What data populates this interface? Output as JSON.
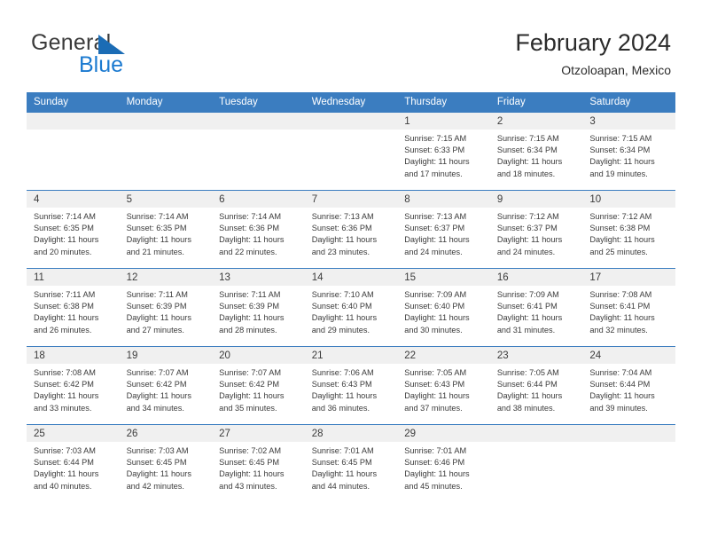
{
  "brand": {
    "name_top": "General",
    "name_bottom": "Blue",
    "triangle_icon": "triangle-icon",
    "accent_blue": "#1b7ad0",
    "header_blue": "#3b7dc0"
  },
  "header": {
    "title": "February 2024",
    "subtitle": "Otzoloapan, Mexico"
  },
  "weekdays": [
    "Sunday",
    "Monday",
    "Tuesday",
    "Wednesday",
    "Thursday",
    "Friday",
    "Saturday"
  ],
  "weeks": [
    [
      {
        "day": "",
        "sunrise": "",
        "sunset": "",
        "daylight_line1": "",
        "daylight_line2": ""
      },
      {
        "day": "",
        "sunrise": "",
        "sunset": "",
        "daylight_line1": "",
        "daylight_line2": ""
      },
      {
        "day": "",
        "sunrise": "",
        "sunset": "",
        "daylight_line1": "",
        "daylight_line2": ""
      },
      {
        "day": "",
        "sunrise": "",
        "sunset": "",
        "daylight_line1": "",
        "daylight_line2": ""
      },
      {
        "day": "1",
        "sunrise": "Sunrise: 7:15 AM",
        "sunset": "Sunset: 6:33 PM",
        "daylight_line1": "Daylight: 11 hours",
        "daylight_line2": "and 17 minutes."
      },
      {
        "day": "2",
        "sunrise": "Sunrise: 7:15 AM",
        "sunset": "Sunset: 6:34 PM",
        "daylight_line1": "Daylight: 11 hours",
        "daylight_line2": "and 18 minutes."
      },
      {
        "day": "3",
        "sunrise": "Sunrise: 7:15 AM",
        "sunset": "Sunset: 6:34 PM",
        "daylight_line1": "Daylight: 11 hours",
        "daylight_line2": "and 19 minutes."
      }
    ],
    [
      {
        "day": "4",
        "sunrise": "Sunrise: 7:14 AM",
        "sunset": "Sunset: 6:35 PM",
        "daylight_line1": "Daylight: 11 hours",
        "daylight_line2": "and 20 minutes."
      },
      {
        "day": "5",
        "sunrise": "Sunrise: 7:14 AM",
        "sunset": "Sunset: 6:35 PM",
        "daylight_line1": "Daylight: 11 hours",
        "daylight_line2": "and 21 minutes."
      },
      {
        "day": "6",
        "sunrise": "Sunrise: 7:14 AM",
        "sunset": "Sunset: 6:36 PM",
        "daylight_line1": "Daylight: 11 hours",
        "daylight_line2": "and 22 minutes."
      },
      {
        "day": "7",
        "sunrise": "Sunrise: 7:13 AM",
        "sunset": "Sunset: 6:36 PM",
        "daylight_line1": "Daylight: 11 hours",
        "daylight_line2": "and 23 minutes."
      },
      {
        "day": "8",
        "sunrise": "Sunrise: 7:13 AM",
        "sunset": "Sunset: 6:37 PM",
        "daylight_line1": "Daylight: 11 hours",
        "daylight_line2": "and 24 minutes."
      },
      {
        "day": "9",
        "sunrise": "Sunrise: 7:12 AM",
        "sunset": "Sunset: 6:37 PM",
        "daylight_line1": "Daylight: 11 hours",
        "daylight_line2": "and 24 minutes."
      },
      {
        "day": "10",
        "sunrise": "Sunrise: 7:12 AM",
        "sunset": "Sunset: 6:38 PM",
        "daylight_line1": "Daylight: 11 hours",
        "daylight_line2": "and 25 minutes."
      }
    ],
    [
      {
        "day": "11",
        "sunrise": "Sunrise: 7:11 AM",
        "sunset": "Sunset: 6:38 PM",
        "daylight_line1": "Daylight: 11 hours",
        "daylight_line2": "and 26 minutes."
      },
      {
        "day": "12",
        "sunrise": "Sunrise: 7:11 AM",
        "sunset": "Sunset: 6:39 PM",
        "daylight_line1": "Daylight: 11 hours",
        "daylight_line2": "and 27 minutes."
      },
      {
        "day": "13",
        "sunrise": "Sunrise: 7:11 AM",
        "sunset": "Sunset: 6:39 PM",
        "daylight_line1": "Daylight: 11 hours",
        "daylight_line2": "and 28 minutes."
      },
      {
        "day": "14",
        "sunrise": "Sunrise: 7:10 AM",
        "sunset": "Sunset: 6:40 PM",
        "daylight_line1": "Daylight: 11 hours",
        "daylight_line2": "and 29 minutes."
      },
      {
        "day": "15",
        "sunrise": "Sunrise: 7:09 AM",
        "sunset": "Sunset: 6:40 PM",
        "daylight_line1": "Daylight: 11 hours",
        "daylight_line2": "and 30 minutes."
      },
      {
        "day": "16",
        "sunrise": "Sunrise: 7:09 AM",
        "sunset": "Sunset: 6:41 PM",
        "daylight_line1": "Daylight: 11 hours",
        "daylight_line2": "and 31 minutes."
      },
      {
        "day": "17",
        "sunrise": "Sunrise: 7:08 AM",
        "sunset": "Sunset: 6:41 PM",
        "daylight_line1": "Daylight: 11 hours",
        "daylight_line2": "and 32 minutes."
      }
    ],
    [
      {
        "day": "18",
        "sunrise": "Sunrise: 7:08 AM",
        "sunset": "Sunset: 6:42 PM",
        "daylight_line1": "Daylight: 11 hours",
        "daylight_line2": "and 33 minutes."
      },
      {
        "day": "19",
        "sunrise": "Sunrise: 7:07 AM",
        "sunset": "Sunset: 6:42 PM",
        "daylight_line1": "Daylight: 11 hours",
        "daylight_line2": "and 34 minutes."
      },
      {
        "day": "20",
        "sunrise": "Sunrise: 7:07 AM",
        "sunset": "Sunset: 6:42 PM",
        "daylight_line1": "Daylight: 11 hours",
        "daylight_line2": "and 35 minutes."
      },
      {
        "day": "21",
        "sunrise": "Sunrise: 7:06 AM",
        "sunset": "Sunset: 6:43 PM",
        "daylight_line1": "Daylight: 11 hours",
        "daylight_line2": "and 36 minutes."
      },
      {
        "day": "22",
        "sunrise": "Sunrise: 7:05 AM",
        "sunset": "Sunset: 6:43 PM",
        "daylight_line1": "Daylight: 11 hours",
        "daylight_line2": "and 37 minutes."
      },
      {
        "day": "23",
        "sunrise": "Sunrise: 7:05 AM",
        "sunset": "Sunset: 6:44 PM",
        "daylight_line1": "Daylight: 11 hours",
        "daylight_line2": "and 38 minutes."
      },
      {
        "day": "24",
        "sunrise": "Sunrise: 7:04 AM",
        "sunset": "Sunset: 6:44 PM",
        "daylight_line1": "Daylight: 11 hours",
        "daylight_line2": "and 39 minutes."
      }
    ],
    [
      {
        "day": "25",
        "sunrise": "Sunrise: 7:03 AM",
        "sunset": "Sunset: 6:44 PM",
        "daylight_line1": "Daylight: 11 hours",
        "daylight_line2": "and 40 minutes."
      },
      {
        "day": "26",
        "sunrise": "Sunrise: 7:03 AM",
        "sunset": "Sunset: 6:45 PM",
        "daylight_line1": "Daylight: 11 hours",
        "daylight_line2": "and 42 minutes."
      },
      {
        "day": "27",
        "sunrise": "Sunrise: 7:02 AM",
        "sunset": "Sunset: 6:45 PM",
        "daylight_line1": "Daylight: 11 hours",
        "daylight_line2": "and 43 minutes."
      },
      {
        "day": "28",
        "sunrise": "Sunrise: 7:01 AM",
        "sunset": "Sunset: 6:45 PM",
        "daylight_line1": "Daylight: 11 hours",
        "daylight_line2": "and 44 minutes."
      },
      {
        "day": "29",
        "sunrise": "Sunrise: 7:01 AM",
        "sunset": "Sunset: 6:46 PM",
        "daylight_line1": "Daylight: 11 hours",
        "daylight_line2": "and 45 minutes."
      },
      {
        "day": "",
        "sunrise": "",
        "sunset": "",
        "daylight_line1": "",
        "daylight_line2": ""
      },
      {
        "day": "",
        "sunrise": "",
        "sunset": "",
        "daylight_line1": "",
        "daylight_line2": ""
      }
    ]
  ]
}
